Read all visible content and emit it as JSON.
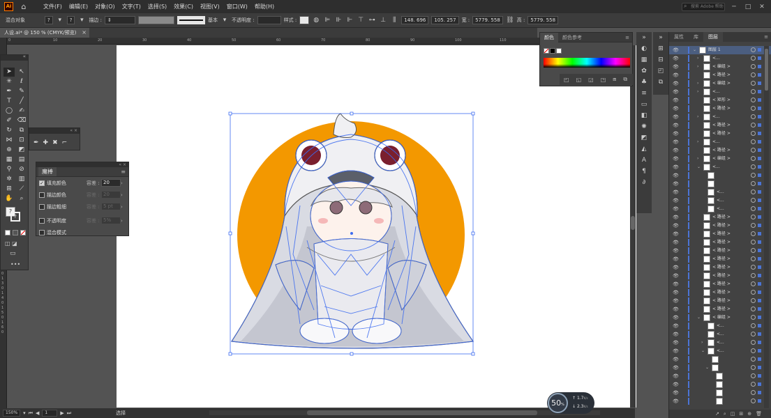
{
  "app": {
    "logo": "Ai",
    "doc_tab": "人设.ai* @ 150 % (CMYK/预览)",
    "close": "×"
  },
  "menu": [
    "文件(F)",
    "编辑(E)",
    "对象(O)",
    "文字(T)",
    "选择(S)",
    "效果(C)",
    "视图(V)",
    "窗口(W)",
    "帮助(H)"
  ],
  "search_placeholder": "搜索 Adobe 帮助",
  "control_bar": {
    "mixed_objects": "混合对象",
    "stroke_label": "描边 :",
    "stroke_style": "基本",
    "opacity_label": "不透明度 :",
    "style_label": "样式 :",
    "x_value": "148. 696",
    "y_value": "105. 257",
    "w_label": "宽 :",
    "w_value": "5779. 558",
    "h_label": "高 :",
    "h_value": "5779. 558"
  },
  "rulers": {
    "h": [
      "0",
      "10",
      "20",
      "30",
      "40",
      "50",
      "60",
      "70",
      "80",
      "90",
      "100",
      "110",
      "120"
    ],
    "v": [
      "9",
      "1",
      "0",
      "1",
      "1",
      "0",
      "1",
      "2",
      "0",
      "1",
      "3",
      "0",
      "1",
      "4",
      "0",
      "1",
      "5",
      "0",
      "1",
      "6",
      "0"
    ]
  },
  "wand_panel": {
    "title": "魔棒",
    "rows": [
      {
        "label": "填充颜色",
        "checked": true,
        "tol_label": "容差 :",
        "tol": "20",
        "dim": false
      },
      {
        "label": "描边颜色",
        "checked": false,
        "tol_label": "容差 :",
        "tol": "20",
        "dim": true
      },
      {
        "label": "描边粗细",
        "checked": false,
        "tol_label": "容差 :",
        "tol": "5 pt",
        "dim": true
      },
      {
        "label": "不透明度",
        "checked": false,
        "tol_label": "容差 :",
        "tol": "5%",
        "dim": true
      },
      {
        "label": "混合模式",
        "checked": false,
        "tol_label": "",
        "tol": "",
        "dim": true
      }
    ]
  },
  "color_panel": {
    "tab_color": "颜色",
    "tab_guide": "颜色参考"
  },
  "layers_panel": {
    "tabs": [
      "属性",
      "库",
      "图层"
    ],
    "rows": [
      {
        "name": "图层 1",
        "indent": 0,
        "arrow": "⌄",
        "sel": true
      },
      {
        "name": "<...",
        "indent": 1,
        "arrow": "›"
      },
      {
        "name": "< 编组 >",
        "indent": 1,
        "arrow": "›"
      },
      {
        "name": "< 路径 >",
        "indent": 1,
        "arrow": ""
      },
      {
        "name": "< 编组 >",
        "indent": 1,
        "arrow": "›"
      },
      {
        "name": "<...",
        "indent": 1,
        "arrow": "›"
      },
      {
        "name": "< 矩形 >",
        "indent": 1,
        "arrow": ""
      },
      {
        "name": "< 路径 >",
        "indent": 1,
        "arrow": ""
      },
      {
        "name": "<...",
        "indent": 1,
        "arrow": "›"
      },
      {
        "name": "< 路径 >",
        "indent": 1,
        "arrow": ""
      },
      {
        "name": "< 路径 >",
        "indent": 1,
        "arrow": ""
      },
      {
        "name": "<...",
        "indent": 1,
        "arrow": "›"
      },
      {
        "name": "< 路径 >",
        "indent": 1,
        "arrow": ""
      },
      {
        "name": "< 编组 >",
        "indent": 1,
        "arrow": "›"
      },
      {
        "name": "<...",
        "indent": 1,
        "arrow": "⌄"
      },
      {
        "name": "",
        "indent": 2,
        "arrow": ""
      },
      {
        "name": "",
        "indent": 2,
        "arrow": ""
      },
      {
        "name": "<...",
        "indent": 2,
        "arrow": ""
      },
      {
        "name": "<...",
        "indent": 2,
        "arrow": ""
      },
      {
        "name": "<...",
        "indent": 2,
        "arrow": ""
      },
      {
        "name": "< 路径 >",
        "indent": 1,
        "arrow": ""
      },
      {
        "name": "< 路径 >",
        "indent": 1,
        "arrow": ""
      },
      {
        "name": "< 路径 >",
        "indent": 1,
        "arrow": ""
      },
      {
        "name": "< 路径 >",
        "indent": 1,
        "arrow": ""
      },
      {
        "name": "< 路径 >",
        "indent": 1,
        "arrow": ""
      },
      {
        "name": "< 路径 >",
        "indent": 1,
        "arrow": ""
      },
      {
        "name": "< 路径 >",
        "indent": 1,
        "arrow": ""
      },
      {
        "name": "< 路径 >",
        "indent": 1,
        "arrow": ""
      },
      {
        "name": "< 路径 >",
        "indent": 1,
        "arrow": ""
      },
      {
        "name": "< 路径 >",
        "indent": 1,
        "arrow": ""
      },
      {
        "name": "< 路径 >",
        "indent": 1,
        "arrow": ""
      },
      {
        "name": "< 路径 >",
        "indent": 1,
        "arrow": ""
      },
      {
        "name": "< 编组 >",
        "indent": 1,
        "arrow": "⌄"
      },
      {
        "name": "<...",
        "indent": 2,
        "arrow": ""
      },
      {
        "name": "<...",
        "indent": 2,
        "arrow": ""
      },
      {
        "name": "<...",
        "indent": 2,
        "arrow": "›"
      },
      {
        "name": "<...",
        "indent": 2,
        "arrow": "⌄"
      },
      {
        "name": "",
        "indent": 3,
        "arrow": ""
      },
      {
        "name": "",
        "indent": 3,
        "arrow": "⌄"
      },
      {
        "name": "",
        "indent": 4,
        "arrow": ""
      },
      {
        "name": "",
        "indent": 4,
        "arrow": ""
      },
      {
        "name": "",
        "indent": 4,
        "arrow": ""
      },
      {
        "name": "",
        "indent": 4,
        "arrow": ""
      }
    ]
  },
  "status_bar": {
    "zoom": "150%",
    "artboard": "1",
    "tool": "选择"
  },
  "memory": {
    "percent": "50",
    "percent_unit": "%",
    "up": "1.7",
    "up_unit": "K/s",
    "down": "2.3",
    "down_unit": "K/s"
  },
  "colors": {
    "accent": "#4b74d6",
    "orange": "#f39800",
    "selection": "#3d6cf0"
  }
}
